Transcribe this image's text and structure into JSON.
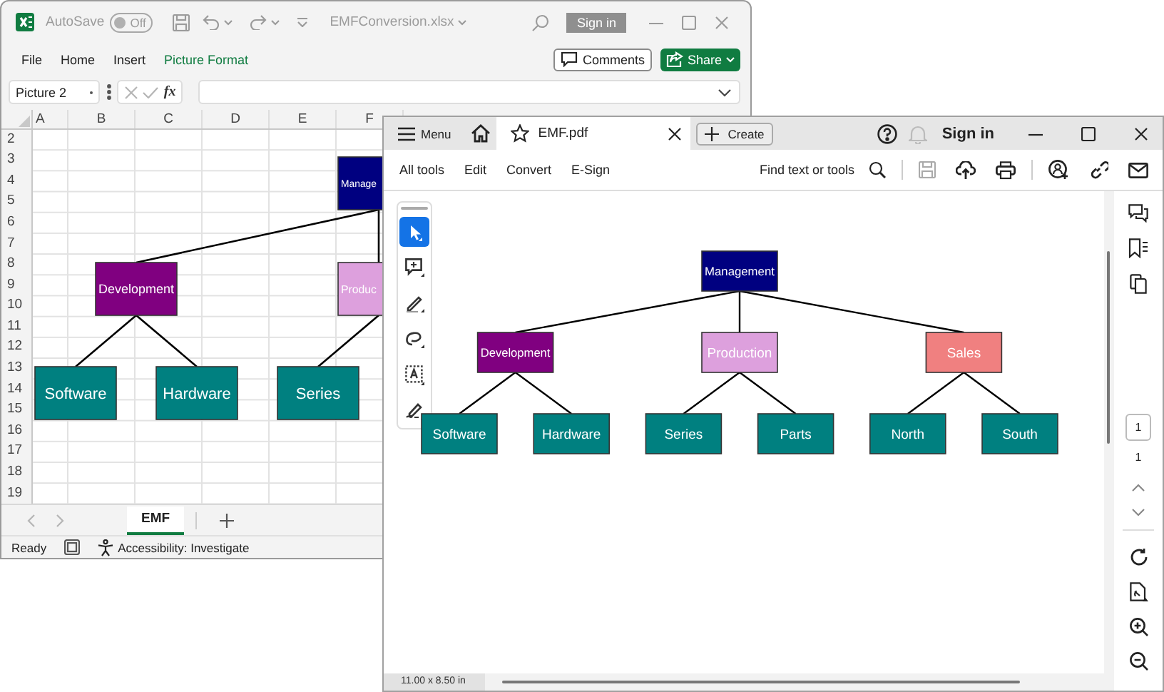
{
  "excel": {
    "title_bar": {
      "autosave_label": "AutoSave",
      "autosave_toggle": {
        "label": "Off",
        "on": false
      },
      "file_name": "EMFConversion.xlsx",
      "sign_in": "Sign in"
    },
    "ribbon_tabs": [
      {
        "label": "File",
        "selected": false
      },
      {
        "label": "Home",
        "selected": false
      },
      {
        "label": "Insert",
        "selected": false
      },
      {
        "label": "Picture Format",
        "selected": true
      }
    ],
    "comments_button": "Comments",
    "share_button": "Share",
    "name_box": "Picture 2",
    "function_label": "fx",
    "columns": [
      "A",
      "B",
      "C",
      "D",
      "E",
      "F"
    ],
    "rows": [
      "2",
      "3",
      "4",
      "5",
      "6",
      "7",
      "8",
      "9",
      "10",
      "11",
      "12",
      "13",
      "14",
      "15",
      "16",
      "17",
      "18",
      "19"
    ],
    "diagram": {
      "label": "Manage",
      "color": "#000080",
      "children": [
        {
          "label": "Development",
          "color": "#800080",
          "children": [
            {
              "label": "Software",
              "color": "#008080"
            },
            {
              "label": "Hardware",
              "color": "#008080"
            }
          ]
        },
        {
          "label": "Produc",
          "color": "#dda0dd",
          "children": [
            {
              "label": "Series",
              "color": "#008080"
            }
          ]
        }
      ]
    },
    "sheet_tabs": [
      {
        "label": "EMF",
        "selected": true
      }
    ],
    "status_bar": {
      "ready": "Ready",
      "accessibility": "Accessibility: Investigate"
    }
  },
  "pdf": {
    "menu": "Menu",
    "tab": "EMF.pdf",
    "create": "Create",
    "sign_in": "Sign in",
    "toolbar": [
      "All tools",
      "Edit",
      "Convert",
      "E-Sign"
    ],
    "search": "Find text or tools",
    "tools": [
      {
        "kind": "select",
        "selected": true
      },
      {
        "kind": "comment",
        "selected": false
      },
      {
        "kind": "highlight",
        "selected": false
      },
      {
        "kind": "draw",
        "selected": false
      },
      {
        "kind": "text",
        "selected": false
      },
      {
        "kind": "sign",
        "selected": false
      }
    ],
    "diagram": {
      "label": "Management",
      "color": "#000080",
      "children": [
        {
          "label": "Development",
          "color": "#800080",
          "children": [
            {
              "label": "Software",
              "color": "#008080"
            },
            {
              "label": "Hardware",
              "color": "#008080"
            }
          ]
        },
        {
          "label": "Production",
          "color": "#dda0dd",
          "children": [
            {
              "label": "Series",
              "color": "#008080"
            },
            {
              "label": "Parts",
              "color": "#008080"
            }
          ]
        },
        {
          "label": "Sales",
          "color": "#f08080",
          "children": [
            {
              "label": "North",
              "color": "#008080"
            },
            {
              "label": "South",
              "color": "#008080"
            }
          ]
        }
      ]
    },
    "page_field": "1",
    "page_count": "1",
    "page_size": "11.00 x 8.50 in"
  }
}
